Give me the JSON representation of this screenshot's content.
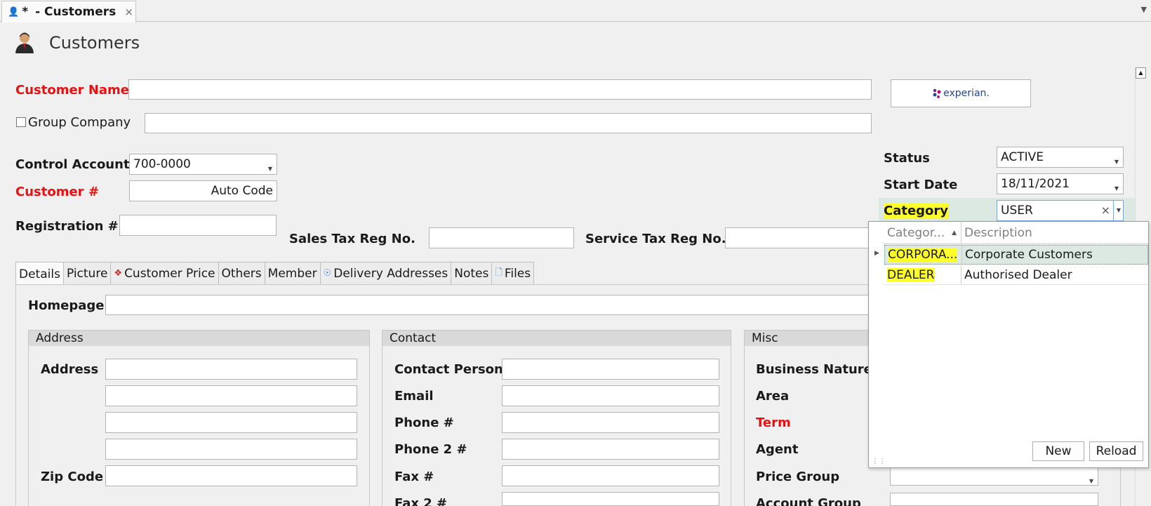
{
  "tab": {
    "modified_marker": "*",
    "title": "- Customers",
    "close": "×"
  },
  "header": {
    "title": "Customers"
  },
  "experian_label": "experian.",
  "form": {
    "customer_name_label": "Customer Name",
    "group_company_label": "Group Company",
    "control_account_label": "Control Account",
    "control_account_value": "700-0000",
    "customer_no_label": "Customer #",
    "customer_no_value": "Auto Code",
    "registration_label": "Registration #",
    "sales_tax_label": "Sales Tax Reg No.",
    "service_tax_label": "Service Tax Reg No.",
    "status_label": "Status",
    "status_value": "ACTIVE",
    "start_date_label": "Start Date",
    "start_date_value": "18/11/2021",
    "category_label": "Category",
    "category_value": "USER",
    "category_clear": "×"
  },
  "tabs": [
    "Details",
    "Picture",
    "Customer Price",
    "Others",
    "Member",
    "Delivery Addresses",
    "Notes",
    "Files"
  ],
  "details": {
    "homepage_label": "Homepage",
    "address_group": {
      "title": "Address",
      "address_label": "Address",
      "zip_label": "Zip Code"
    },
    "contact_group": {
      "title": "Contact",
      "labels": [
        "Contact Person",
        "Email",
        "Phone #",
        "Phone 2 #",
        "Fax #",
        "Fax 2 #"
      ]
    },
    "misc_group": {
      "title": "Misc",
      "labels": [
        "Business Nature",
        "Area",
        "Term",
        "Agent",
        "Price Group",
        "Account Group"
      ]
    }
  },
  "category_dropdown": {
    "columns": [
      "Categor...",
      "Description"
    ],
    "rows": [
      {
        "code": "CORPORA...",
        "description": "Corporate Customers"
      },
      {
        "code": "DEALER",
        "description": "Authorised Dealer"
      }
    ],
    "new_label": "New",
    "reload_label": "Reload"
  },
  "colors": {
    "required_label": "#e81010",
    "highlight": "#ffff2a",
    "selected_row": "#dce9e2"
  }
}
